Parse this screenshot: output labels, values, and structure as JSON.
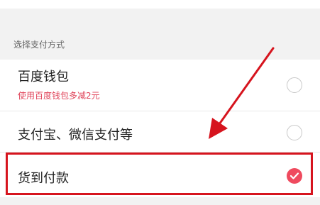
{
  "section_title": "选择支付方式",
  "options": [
    {
      "label": "百度钱包",
      "sub": "使用百度钱包多减2元",
      "selected": false
    },
    {
      "label": "支付宝、微信支付等",
      "sub": "",
      "selected": false
    },
    {
      "label": "货到付款",
      "sub": "",
      "selected": true
    }
  ],
  "colors": {
    "accent": "#ef4a5e",
    "promo_text": "#e0445a",
    "annotation": "#d6141e",
    "section_bg": "#f2f2f2"
  },
  "icons": {
    "selected_radio": "check-icon",
    "unselected_radio": "radio-empty-icon"
  }
}
